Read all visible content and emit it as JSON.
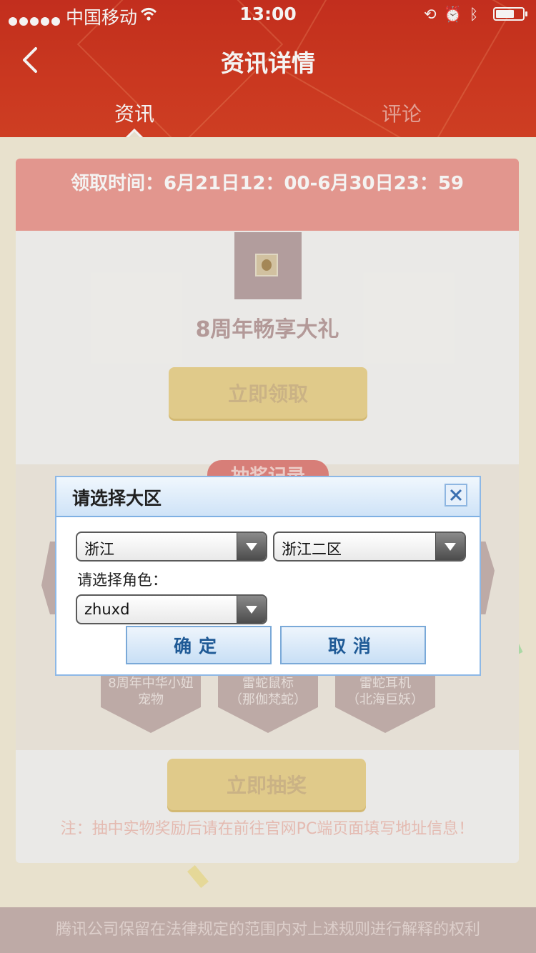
{
  "status_bar": {
    "carrier": "中国移动",
    "time": "13:00",
    "battery_level": 0.7
  },
  "header": {
    "title": "资讯详情",
    "tabs": [
      {
        "label": "资讯",
        "active": true
      },
      {
        "label": "评论",
        "active": false
      }
    ]
  },
  "event": {
    "time_range": "领取时间：6月21日12：00-6月30日23：59",
    "gift_name": "8周年畅享大礼",
    "claim_button": "立即领取",
    "record_tab": "抽奖记录",
    "prizes": [
      {
        "line1": "8周年中华小妞",
        "line2": "宠物"
      },
      {
        "line1": "雷蛇鼠标",
        "line2": "（那伽梵蛇）"
      },
      {
        "line1": "雷蛇耳机",
        "line2": "（北海巨妖）"
      }
    ],
    "draw_button": "立即抽奖",
    "note": "注：抽中实物奖励后请在前往官网PC端页面填写地址信息！"
  },
  "footer": {
    "text": "腾讯公司保留在法律规定的范围内对上述规则进行解释的权利"
  },
  "dialog": {
    "title": "请选择大区",
    "province": "浙江",
    "zone": "浙江二区",
    "role_label": "请选择角色：",
    "role": "zhuxd",
    "ok_button": "确定",
    "cancel_button": "取消"
  },
  "colors": {
    "header_red": "#d2351c",
    "dialog_border": "#8db8e6",
    "button_text_blue": "#1f5a96"
  }
}
